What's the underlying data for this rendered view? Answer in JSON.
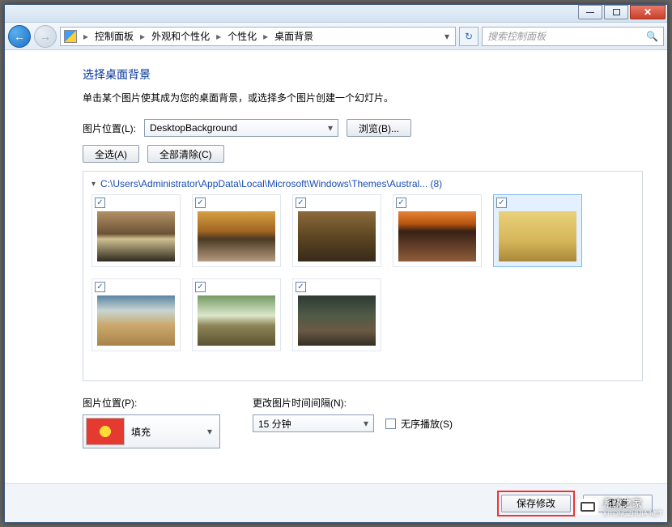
{
  "titlebar": {
    "minimize": "—",
    "maximize": "□",
    "close": "✕"
  },
  "breadcrumb": {
    "items": [
      "控制面板",
      "外观和个性化",
      "个性化",
      "桌面背景"
    ],
    "sep": "▸",
    "dropdown": "▾",
    "refresh": "↻"
  },
  "search": {
    "placeholder": "搜索控制面板",
    "icon": "🔍"
  },
  "page": {
    "title": "选择桌面背景",
    "description": "单击某个图片使其成为您的桌面背景，或选择多个图片创建一个幻灯片。"
  },
  "location": {
    "label": "图片位置(L):",
    "value": "DesktopBackground",
    "browse": "浏览(B)..."
  },
  "selection": {
    "select_all": "全选(A)",
    "clear_all": "全部清除(C)"
  },
  "group": {
    "triangle": "▾",
    "path": "C:\\Users\\Administrator\\AppData\\Local\\Microsoft\\Windows\\Themes\\Austral... (8)"
  },
  "thumbs": [
    {
      "name": "australia-1",
      "checked": true,
      "selected": false
    },
    {
      "name": "australia-2",
      "checked": true,
      "selected": false
    },
    {
      "name": "australia-3",
      "checked": true,
      "selected": false
    },
    {
      "name": "australia-4",
      "checked": true,
      "selected": false
    },
    {
      "name": "australia-5",
      "checked": true,
      "selected": true
    },
    {
      "name": "australia-6",
      "checked": true,
      "selected": false
    },
    {
      "name": "australia-7",
      "checked": true,
      "selected": false
    },
    {
      "name": "australia-8",
      "checked": true,
      "selected": false
    }
  ],
  "check_glyph": "✓",
  "position": {
    "label": "图片位置(P):",
    "value": "填充"
  },
  "interval": {
    "label": "更改图片时间间隔(N):",
    "value": "15 分钟"
  },
  "shuffle": {
    "label": "无序播放(S)"
  },
  "footer": {
    "save": "保存修改",
    "cancel": "取消"
  },
  "nav_arrows": {
    "back": "←",
    "fwd": "→"
  },
  "watermark": {
    "text": "系统之家",
    "sub": "XITONGZHIJIA.NET"
  }
}
